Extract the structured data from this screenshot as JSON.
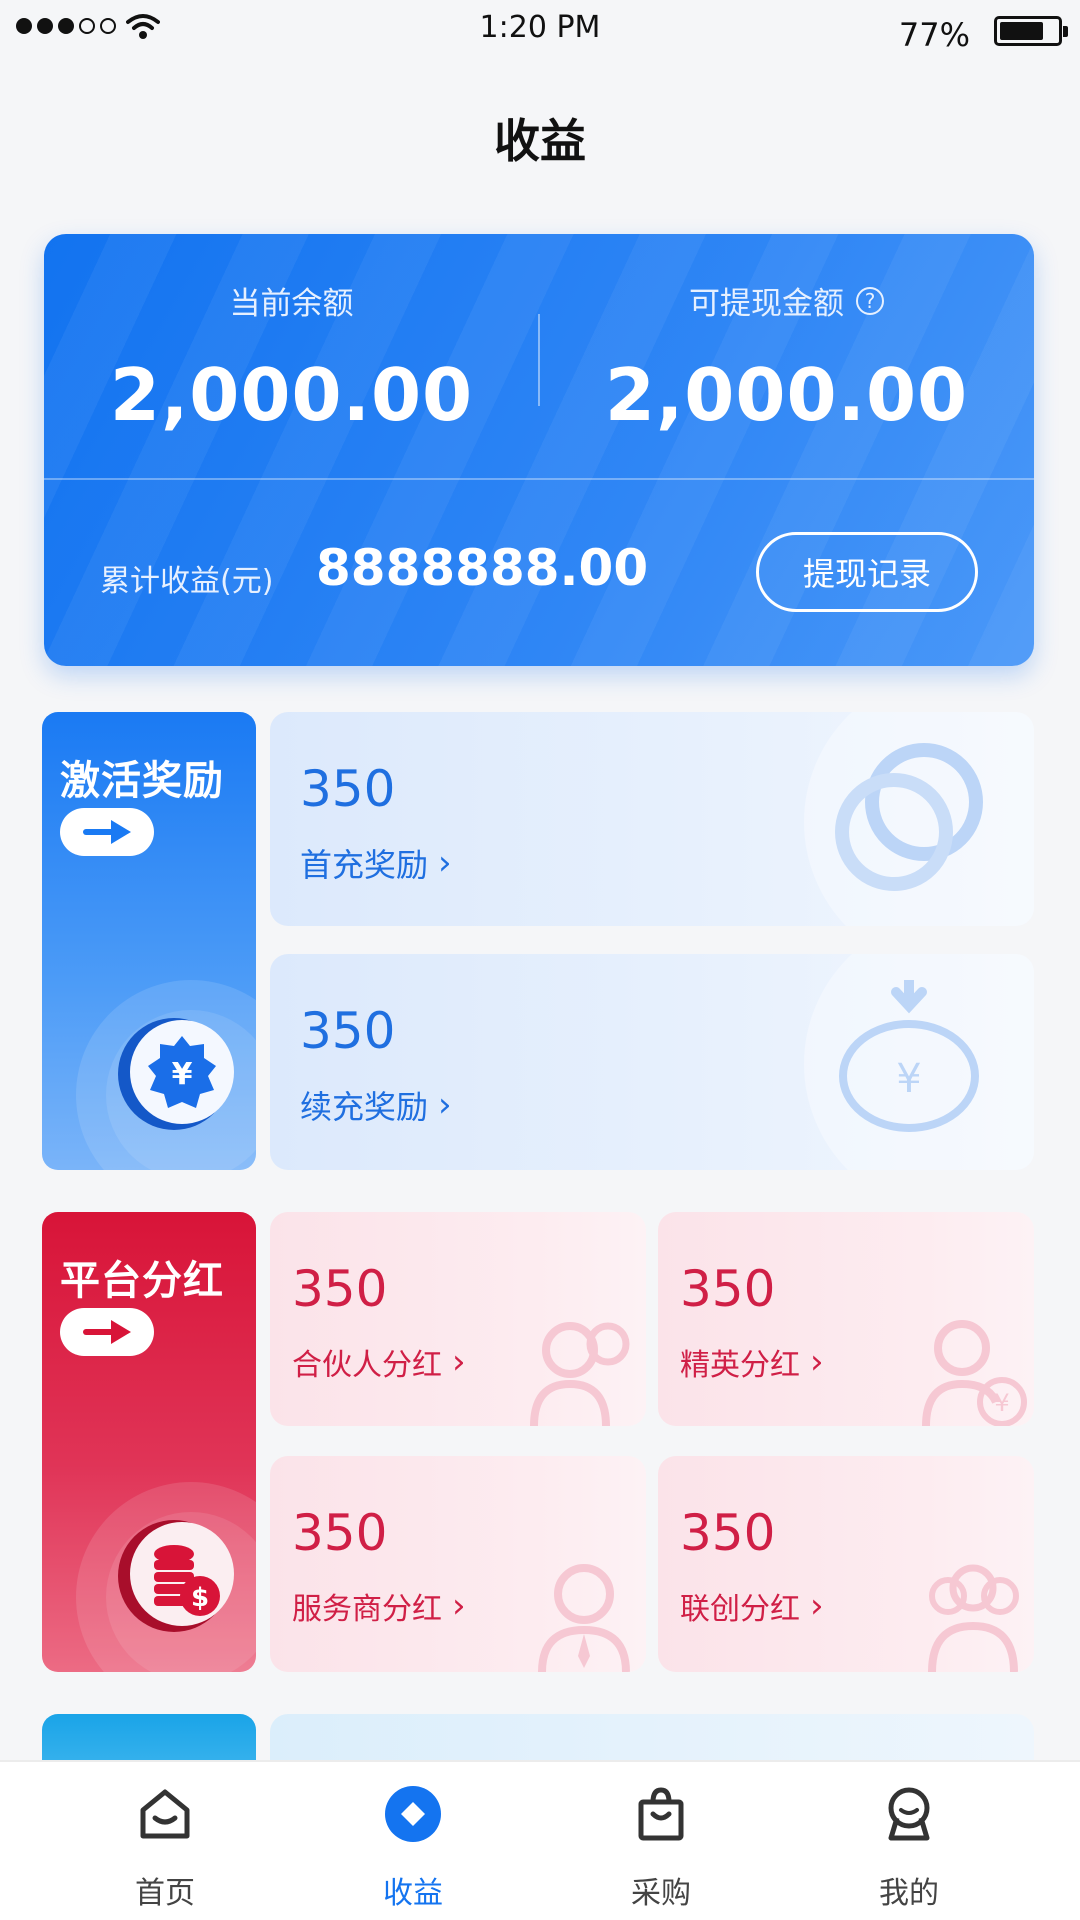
{
  "status_bar": {
    "time": "1:20 PM",
    "battery": "77%",
    "battery_level": 0.77
  },
  "page_title": "收益",
  "balance": {
    "current_label": "当前余额",
    "current_value": "2,000.00",
    "withdrawable_label": "可提现金额",
    "withdrawable_value": "2,000.00",
    "cumulative_label": "累计收益(元)",
    "cumulative_value": "8888888.00",
    "withdraw_records_label": "提现记录"
  },
  "activation": {
    "title": "激活奖励",
    "items": [
      {
        "value": "350",
        "label": "首充奖励"
      },
      {
        "value": "350",
        "label": "续充奖励"
      }
    ]
  },
  "platform": {
    "title": "平台分红",
    "items": [
      {
        "value": "350",
        "label": "合伙人分红"
      },
      {
        "value": "350",
        "label": "精英分红"
      },
      {
        "value": "350",
        "label": "服务商分红"
      },
      {
        "value": "350",
        "label": "联创分红"
      }
    ]
  },
  "tabs": [
    {
      "label": "首页",
      "icon": "home-icon"
    },
    {
      "label": "收益",
      "icon": "earnings-icon",
      "active": true
    },
    {
      "label": "采购",
      "icon": "shopping-bag-icon"
    },
    {
      "label": "我的",
      "icon": "profile-icon"
    }
  ],
  "colors": {
    "primary_blue": "#1474f0",
    "accent_red": "#d01f46"
  }
}
